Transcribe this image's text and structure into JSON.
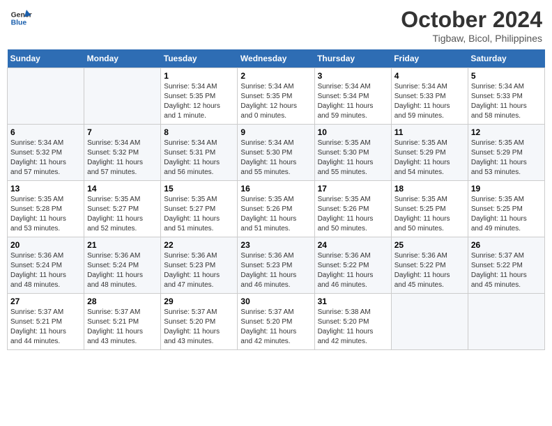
{
  "header": {
    "logo_line1": "General",
    "logo_line2": "Blue",
    "main_title": "October 2024",
    "subtitle": "Tigbaw, Bicol, Philippines"
  },
  "calendar": {
    "days_of_week": [
      "Sunday",
      "Monday",
      "Tuesday",
      "Wednesday",
      "Thursday",
      "Friday",
      "Saturday"
    ],
    "weeks": [
      [
        {
          "day": "",
          "info": ""
        },
        {
          "day": "",
          "info": ""
        },
        {
          "day": "1",
          "info": "Sunrise: 5:34 AM\nSunset: 5:35 PM\nDaylight: 12 hours\nand 1 minute."
        },
        {
          "day": "2",
          "info": "Sunrise: 5:34 AM\nSunset: 5:35 PM\nDaylight: 12 hours\nand 0 minutes."
        },
        {
          "day": "3",
          "info": "Sunrise: 5:34 AM\nSunset: 5:34 PM\nDaylight: 11 hours\nand 59 minutes."
        },
        {
          "day": "4",
          "info": "Sunrise: 5:34 AM\nSunset: 5:33 PM\nDaylight: 11 hours\nand 59 minutes."
        },
        {
          "day": "5",
          "info": "Sunrise: 5:34 AM\nSunset: 5:33 PM\nDaylight: 11 hours\nand 58 minutes."
        }
      ],
      [
        {
          "day": "6",
          "info": "Sunrise: 5:34 AM\nSunset: 5:32 PM\nDaylight: 11 hours\nand 57 minutes."
        },
        {
          "day": "7",
          "info": "Sunrise: 5:34 AM\nSunset: 5:32 PM\nDaylight: 11 hours\nand 57 minutes."
        },
        {
          "day": "8",
          "info": "Sunrise: 5:34 AM\nSunset: 5:31 PM\nDaylight: 11 hours\nand 56 minutes."
        },
        {
          "day": "9",
          "info": "Sunrise: 5:34 AM\nSunset: 5:30 PM\nDaylight: 11 hours\nand 55 minutes."
        },
        {
          "day": "10",
          "info": "Sunrise: 5:35 AM\nSunset: 5:30 PM\nDaylight: 11 hours\nand 55 minutes."
        },
        {
          "day": "11",
          "info": "Sunrise: 5:35 AM\nSunset: 5:29 PM\nDaylight: 11 hours\nand 54 minutes."
        },
        {
          "day": "12",
          "info": "Sunrise: 5:35 AM\nSunset: 5:29 PM\nDaylight: 11 hours\nand 53 minutes."
        }
      ],
      [
        {
          "day": "13",
          "info": "Sunrise: 5:35 AM\nSunset: 5:28 PM\nDaylight: 11 hours\nand 53 minutes."
        },
        {
          "day": "14",
          "info": "Sunrise: 5:35 AM\nSunset: 5:27 PM\nDaylight: 11 hours\nand 52 minutes."
        },
        {
          "day": "15",
          "info": "Sunrise: 5:35 AM\nSunset: 5:27 PM\nDaylight: 11 hours\nand 51 minutes."
        },
        {
          "day": "16",
          "info": "Sunrise: 5:35 AM\nSunset: 5:26 PM\nDaylight: 11 hours\nand 51 minutes."
        },
        {
          "day": "17",
          "info": "Sunrise: 5:35 AM\nSunset: 5:26 PM\nDaylight: 11 hours\nand 50 minutes."
        },
        {
          "day": "18",
          "info": "Sunrise: 5:35 AM\nSunset: 5:25 PM\nDaylight: 11 hours\nand 50 minutes."
        },
        {
          "day": "19",
          "info": "Sunrise: 5:35 AM\nSunset: 5:25 PM\nDaylight: 11 hours\nand 49 minutes."
        }
      ],
      [
        {
          "day": "20",
          "info": "Sunrise: 5:36 AM\nSunset: 5:24 PM\nDaylight: 11 hours\nand 48 minutes."
        },
        {
          "day": "21",
          "info": "Sunrise: 5:36 AM\nSunset: 5:24 PM\nDaylight: 11 hours\nand 48 minutes."
        },
        {
          "day": "22",
          "info": "Sunrise: 5:36 AM\nSunset: 5:23 PM\nDaylight: 11 hours\nand 47 minutes."
        },
        {
          "day": "23",
          "info": "Sunrise: 5:36 AM\nSunset: 5:23 PM\nDaylight: 11 hours\nand 46 minutes."
        },
        {
          "day": "24",
          "info": "Sunrise: 5:36 AM\nSunset: 5:22 PM\nDaylight: 11 hours\nand 46 minutes."
        },
        {
          "day": "25",
          "info": "Sunrise: 5:36 AM\nSunset: 5:22 PM\nDaylight: 11 hours\nand 45 minutes."
        },
        {
          "day": "26",
          "info": "Sunrise: 5:37 AM\nSunset: 5:22 PM\nDaylight: 11 hours\nand 45 minutes."
        }
      ],
      [
        {
          "day": "27",
          "info": "Sunrise: 5:37 AM\nSunset: 5:21 PM\nDaylight: 11 hours\nand 44 minutes."
        },
        {
          "day": "28",
          "info": "Sunrise: 5:37 AM\nSunset: 5:21 PM\nDaylight: 11 hours\nand 43 minutes."
        },
        {
          "day": "29",
          "info": "Sunrise: 5:37 AM\nSunset: 5:20 PM\nDaylight: 11 hours\nand 43 minutes."
        },
        {
          "day": "30",
          "info": "Sunrise: 5:37 AM\nSunset: 5:20 PM\nDaylight: 11 hours\nand 42 minutes."
        },
        {
          "day": "31",
          "info": "Sunrise: 5:38 AM\nSunset: 5:20 PM\nDaylight: 11 hours\nand 42 minutes."
        },
        {
          "day": "",
          "info": ""
        },
        {
          "day": "",
          "info": ""
        }
      ]
    ]
  }
}
